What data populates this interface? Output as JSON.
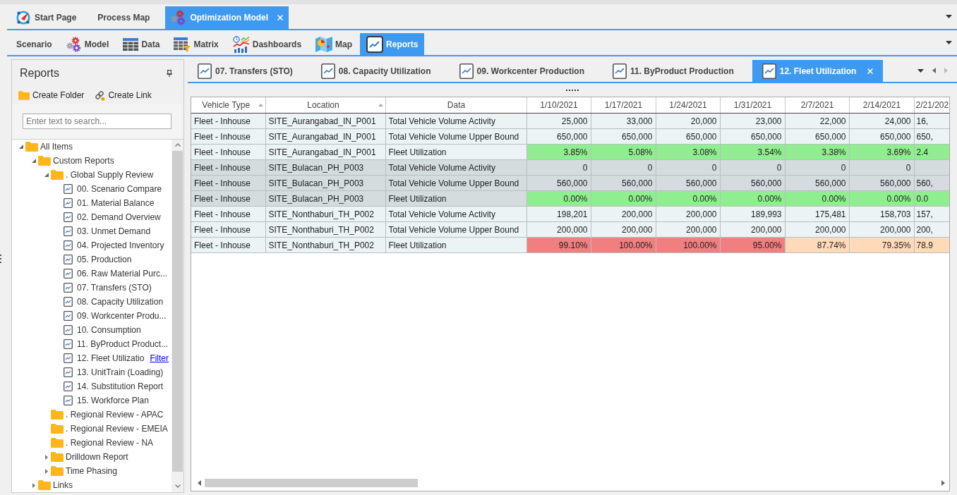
{
  "document_tabs": [
    {
      "label": "Start Page",
      "kind": "start",
      "selected": false,
      "closable": false
    },
    {
      "label": "Process Map",
      "kind": "plain",
      "selected": false,
      "closable": false
    },
    {
      "label": "Optimization Model",
      "kind": "model",
      "selected": true,
      "closable": true
    }
  ],
  "ribbon_tabs": [
    {
      "label": "Scenario",
      "kind": "plain",
      "selected": false
    },
    {
      "label": "Model",
      "kind": "model",
      "selected": false
    },
    {
      "label": "Data",
      "kind": "data",
      "selected": false
    },
    {
      "label": "Matrix",
      "kind": "matrix",
      "selected": false
    },
    {
      "label": "Dashboards",
      "kind": "dashboards",
      "selected": false
    },
    {
      "label": "Map",
      "kind": "map",
      "selected": false
    },
    {
      "label": "Reports",
      "kind": "reports",
      "selected": true
    }
  ],
  "reports_panel": {
    "title": "Reports",
    "actions": [
      {
        "label": "Create Folder",
        "kind": "folder"
      },
      {
        "label": "Create Link",
        "kind": "link"
      }
    ],
    "search": {
      "placeholder": "Enter text to search..."
    },
    "tree": [
      {
        "label": "All Items",
        "kind": "folder",
        "expanded": true,
        "children": [
          {
            "label": "Custom Reports",
            "kind": "folder",
            "expanded": true,
            "children": [
              {
                "label": ". Global Supply Review",
                "kind": "folder",
                "expanded": true,
                "children": [
                  {
                    "label": "00. Scenario Compare",
                    "kind": "report"
                  },
                  {
                    "label": "01. Material Balance",
                    "kind": "report"
                  },
                  {
                    "label": "02. Demand Overview",
                    "kind": "report"
                  },
                  {
                    "label": "03. Unmet Demand",
                    "kind": "report"
                  },
                  {
                    "label": "04. Projected Inventory",
                    "kind": "report"
                  },
                  {
                    "label": "05. Production",
                    "kind": "report"
                  },
                  {
                    "label": "06. Raw Material Purc...",
                    "kind": "report"
                  },
                  {
                    "label": "07. Transfers (STO)",
                    "kind": "report"
                  },
                  {
                    "label": "08. Capacity Utilization",
                    "kind": "report"
                  },
                  {
                    "label": "09. Workcenter Produ...",
                    "kind": "report"
                  },
                  {
                    "label": "10. Consumption",
                    "kind": "report"
                  },
                  {
                    "label": "11. ByProduct Product...",
                    "kind": "report"
                  },
                  {
                    "label": "12. Fleet Utilizatio",
                    "kind": "report",
                    "link": "Filter"
                  },
                  {
                    "label": "13. UnitTrain (Loading)",
                    "kind": "report"
                  },
                  {
                    "label": "14. Substitution Report",
                    "kind": "report"
                  },
                  {
                    "label": "15. Workforce Plan",
                    "kind": "report"
                  }
                ]
              },
              {
                "label": ". Regional Review - APAC",
                "kind": "folder"
              },
              {
                "label": ". Regional Review - EMEIA",
                "kind": "folder"
              },
              {
                "label": ". Regional Review - NA",
                "kind": "folder"
              },
              {
                "label": "Drilldown Report",
                "kind": "folder",
                "expanded": false
              },
              {
                "label": "Time Phasing",
                "kind": "folder",
                "expanded": false
              }
            ]
          },
          {
            "label": "Links",
            "kind": "folder",
            "expanded": false
          }
        ]
      }
    ]
  },
  "report_tabs": [
    {
      "label": "07. Transfers (STO)",
      "selected": false,
      "closable": false
    },
    {
      "label": "08. Capacity Utilization",
      "selected": false,
      "closable": false
    },
    {
      "label": "09. Workcenter Production",
      "selected": false,
      "closable": false
    },
    {
      "label": "11. ByProduct Production",
      "selected": false,
      "closable": false
    },
    {
      "label": "12. Fleet Utilization",
      "selected": true,
      "closable": true
    }
  ],
  "grid": {
    "columns": [
      {
        "label": "Vehicle Type",
        "sorted": true
      },
      {
        "label": "Location",
        "sorted": true
      },
      {
        "label": "Data",
        "sorted": false
      },
      {
        "label": "1/10/2021",
        "sorted": false
      },
      {
        "label": "1/17/2021",
        "sorted": false
      },
      {
        "label": "1/24/2021",
        "sorted": false
      },
      {
        "label": "1/31/2021",
        "sorted": false
      },
      {
        "label": "2/7/2021",
        "sorted": false
      },
      {
        "label": "2/14/2021",
        "sorted": false
      },
      {
        "label": "2/21/202"
      }
    ],
    "rows": [
      {
        "shaded": false,
        "cells": [
          "Fleet - Inhouse",
          "SITE_Aurangabad_IN_P001",
          "Total Vehicle Volume Activity",
          "25,000",
          "33,000",
          "20,000",
          "23,000",
          "22,000",
          "24,000",
          "16,"
        ]
      },
      {
        "shaded": false,
        "cells": [
          "Fleet - Inhouse",
          "SITE_Aurangabad_IN_P001",
          "Total Vehicle Volume Upper Bound",
          "650,000",
          "650,000",
          "650,000",
          "650,000",
          "650,000",
          "650,000",
          "650,"
        ]
      },
      {
        "shaded": false,
        "cells": [
          "Fleet - Inhouse",
          "SITE_Aurangabad_IN_P001",
          "Fleet Utilization",
          {
            "text": "3.85%",
            "color": "#90ee90"
          },
          {
            "text": "5.08%",
            "color": "#90ee90"
          },
          {
            "text": "3.08%",
            "color": "#90ee90"
          },
          {
            "text": "3.54%",
            "color": "#90ee90"
          },
          {
            "text": "3.38%",
            "color": "#90ee90"
          },
          {
            "text": "3.69%",
            "color": "#90ee90"
          },
          {
            "text": "2.4",
            "color": "#90ee90"
          }
        ]
      },
      {
        "shaded": true,
        "cells": [
          "Fleet - Inhouse",
          "SITE_Bulacan_PH_P003",
          "Total Vehicle Volume Activity",
          "0",
          "0",
          "0",
          "0",
          "0",
          "0"
        ]
      },
      {
        "shaded": true,
        "cells": [
          "Fleet - Inhouse",
          "SITE_Bulacan_PH_P003",
          "Total Vehicle Volume Upper Bound",
          "560,000",
          "560,000",
          "560,000",
          "560,000",
          "560,000",
          "560,000",
          "560,"
        ]
      },
      {
        "shaded": true,
        "cells": [
          "Fleet - Inhouse",
          "SITE_Bulacan_PH_P003",
          "Fleet Utilization",
          {
            "text": "0.00%",
            "color": "#90ee90"
          },
          {
            "text": "0.00%",
            "color": "#90ee90"
          },
          {
            "text": "0.00%",
            "color": "#90ee90"
          },
          {
            "text": "0.00%",
            "color": "#90ee90"
          },
          {
            "text": "0.00%",
            "color": "#90ee90"
          },
          {
            "text": "0.00%",
            "color": "#90ee90"
          },
          {
            "text": "0.0",
            "color": "#90ee90"
          }
        ]
      },
      {
        "shaded": false,
        "cells": [
          "Fleet - Inhouse",
          "SITE_Nonthaburi_TH_P002",
          "Total Vehicle Volume Activity",
          "198,201",
          "200,000",
          "200,000",
          "189,993",
          "175,481",
          "158,703",
          "157,"
        ]
      },
      {
        "shaded": false,
        "cells": [
          "Fleet - Inhouse",
          "SITE_Nonthaburi_TH_P002",
          "Total Vehicle Volume Upper Bound",
          "200,000",
          "200,000",
          "200,000",
          "200,000",
          "200,000",
          "200,000",
          "200,"
        ]
      },
      {
        "shaded": false,
        "cells": [
          "Fleet - Inhouse",
          "SITE_Nonthaburi_TH_P002",
          "Fleet Utilization",
          {
            "text": "99.10%",
            "color": "#f08080"
          },
          {
            "text": "100.00%",
            "color": "#f08080"
          },
          {
            "text": "100.00%",
            "color": "#f08080"
          },
          {
            "text": "95.00%",
            "color": "#f08080"
          },
          {
            "text": "87.74%",
            "color": "#ffdab9"
          },
          {
            "text": "79.35%",
            "color": "#ffdab9"
          },
          {
            "text": "78.9",
            "color": "#ffdab9"
          }
        ]
      }
    ]
  }
}
